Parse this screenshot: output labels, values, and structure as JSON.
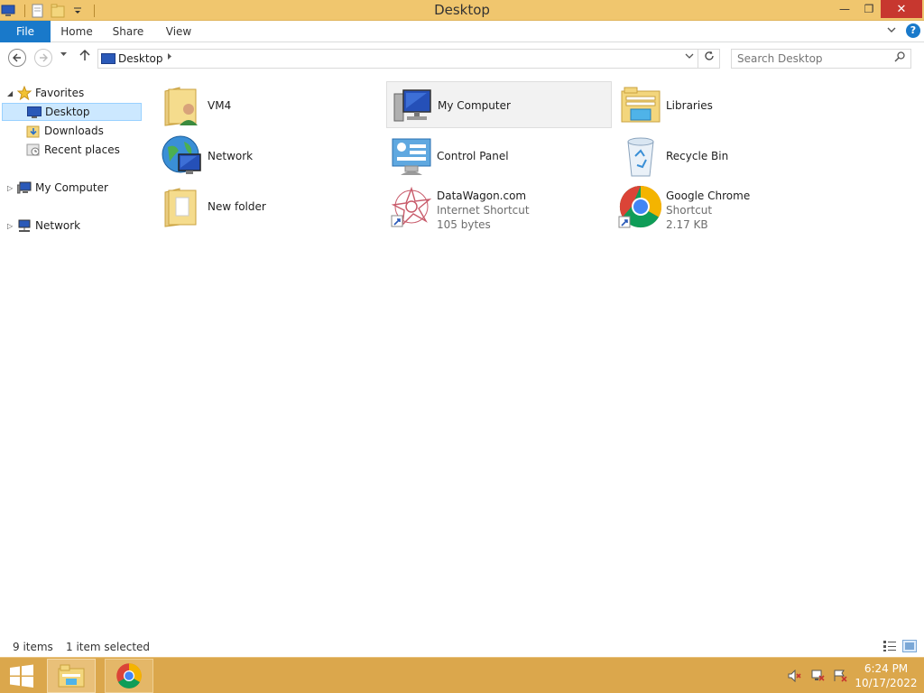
{
  "window": {
    "title": "Desktop"
  },
  "window_controls": {
    "minimize": "—",
    "maximize": "❐",
    "close": "✕"
  },
  "ribbon": {
    "tabs": [
      {
        "label": "File",
        "active": true
      },
      {
        "label": "Home"
      },
      {
        "label": "Share"
      },
      {
        "label": "View"
      }
    ],
    "help": "?",
    "accent_color": "#1979ca"
  },
  "address": {
    "location": "Desktop",
    "search_placeholder": "Search Desktop"
  },
  "navigation": {
    "favorites_label": "Favorites",
    "items": [
      {
        "label": "Desktop",
        "selected": true
      },
      {
        "label": "Downloads"
      },
      {
        "label": "Recent places"
      }
    ],
    "my_computer_label": "My Computer",
    "network_label": "Network"
  },
  "files": [
    {
      "name": "VM4",
      "icon": "user-folder-icon"
    },
    {
      "name": "My Computer",
      "icon": "computer-icon",
      "selected": true
    },
    {
      "name": "Libraries",
      "icon": "libraries-icon"
    },
    {
      "name": "Network",
      "icon": "network-globe-icon"
    },
    {
      "name": "Control Panel",
      "icon": "control-panel-icon"
    },
    {
      "name": "Recycle Bin",
      "icon": "recycle-bin-icon"
    },
    {
      "name": "New folder",
      "icon": "folder-icon"
    },
    {
      "name": "DataWagon.com",
      "type": "Internet Shortcut",
      "size": "105 bytes",
      "icon": "datawagon-shortcut-icon"
    },
    {
      "name": "Google Chrome",
      "type": "Shortcut",
      "size": "2.17 KB",
      "icon": "chrome-shortcut-icon"
    }
  ],
  "status": {
    "item_count": "9 items",
    "selection": "1 item selected"
  },
  "taskbar": {
    "time": "6:24 PM",
    "date": "10/17/2022",
    "color": "#dba74c"
  },
  "colors": {
    "titlebar": "#f0c66e",
    "close_button": "#c7372f",
    "selection": "#cce8ff"
  }
}
